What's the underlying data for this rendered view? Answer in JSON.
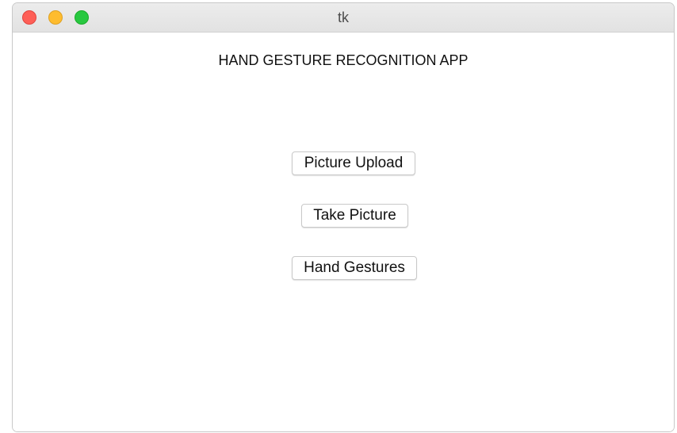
{
  "window": {
    "title": "tk"
  },
  "app": {
    "heading": "HAND GESTURE RECOGNITION APP",
    "buttons": {
      "picture_upload": "Picture Upload",
      "take_picture": "Take Picture",
      "hand_gestures": "Hand Gestures"
    }
  },
  "colors": {
    "close": "#fe5f57",
    "minimize": "#febc2e",
    "zoom": "#28c840",
    "background": "#ffffff"
  }
}
